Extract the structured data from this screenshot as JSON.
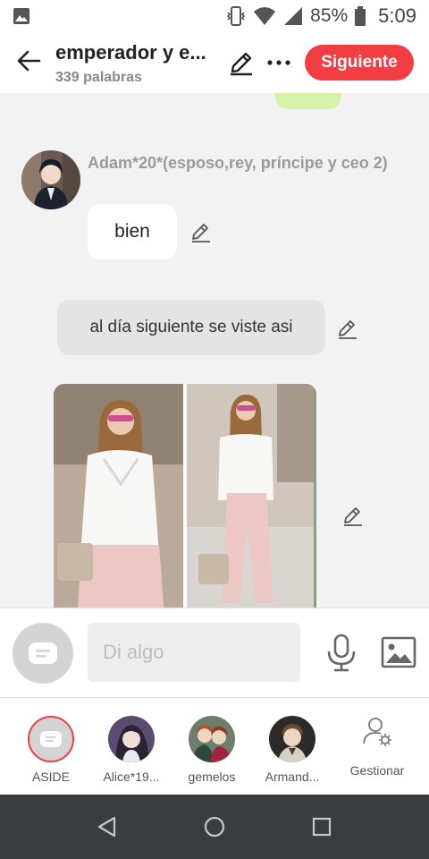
{
  "status_bar": {
    "battery_percent": "85%",
    "time": "5:09",
    "icons": [
      "image-icon",
      "vibrate-icon",
      "wifi-icon",
      "signal-icon",
      "battery-icon"
    ]
  },
  "header": {
    "title": "emperador y e...",
    "subtitle": "339 palabras",
    "next_label": "Siguiente",
    "accent_color": "#f23d42"
  },
  "chat": {
    "messages": [
      {
        "type": "character",
        "author": "Adam*20*(esposo,rey, príncipe y ceo 2)",
        "text": "bien"
      },
      {
        "type": "narration",
        "text": "al día siguiente se viste asi"
      },
      {
        "type": "image",
        "description_icon": "photo"
      }
    ]
  },
  "input": {
    "placeholder": "Di algo"
  },
  "characters": [
    {
      "name": "ASIDE",
      "selected": true
    },
    {
      "name": "Alice*19..."
    },
    {
      "name": "gemelos"
    },
    {
      "name": "Armand..."
    }
  ],
  "manage_label": "Gestionar"
}
